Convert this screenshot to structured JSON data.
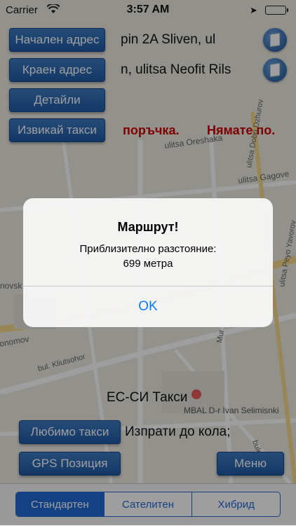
{
  "status_bar": {
    "carrier": "Carrier",
    "time": "3:57 AM"
  },
  "form": {
    "start_button": "Начален адрес",
    "start_value": "pin 2A    Sliven, ul",
    "end_button": "Краен адрес",
    "end_value": "n, ulitsa Neofit Rils",
    "details_button": "Детайли",
    "call_button": "Извикай такси",
    "order_text": "поръчка.",
    "no_text": "Нямате по."
  },
  "map_labels": {
    "street1": "ulitsa Oreshaka",
    "street2": "ulitsa Gagove",
    "street3": "ulitsa Dobri Dzhurov",
    "street4": "ulitsa Peyo Yavorov",
    "street5": "novsk",
    "street6": "onomov",
    "street7": "bul. Kliutsohor",
    "poi": "MBAL D-r Ivan Selimisnki",
    "street8": "Mur",
    "street9": "bulev"
  },
  "taxi_label": "ЕС-СИ Такси",
  "favorite_button": "Любимо такси",
  "send_label": "Изпрати до кола;",
  "gps_button": "GPS Позиция",
  "menu_button": "Меню",
  "alert": {
    "title": "Маршрут!",
    "message_line1": "Приблизително разстояние:",
    "message_line2": "699 метра",
    "ok": "OK"
  },
  "segments": {
    "standard": "Стандартен",
    "satellite": "Сателитен",
    "hybrid": "Хибрид"
  }
}
